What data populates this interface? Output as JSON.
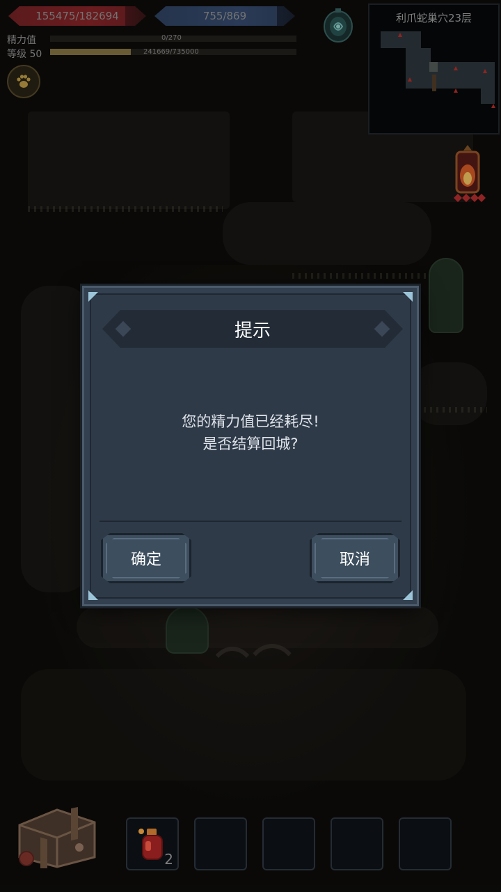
{
  "hud": {
    "hp_text": "155475/182694",
    "hp_fraction": 0.851,
    "mp_text": "755/869",
    "mp_fraction": 0.869,
    "energy_label": "精力值",
    "energy_text": "0/270",
    "energy_fraction": 0,
    "level_label": "等级 50",
    "exp_text": "241669/735000",
    "exp_fraction": 0.329,
    "paw_icon": "paw-icon",
    "portal_icon": "portal-icon",
    "lantern_icon": "lantern-icon"
  },
  "minimap": {
    "title": "利爪蛇巢穴23层"
  },
  "dialog": {
    "title": "提示",
    "message_line1": "您的精力值已经耗尽!",
    "message_line2": "是否结算回城?",
    "confirm_label": "确定",
    "cancel_label": "取消"
  },
  "bottom_bar": {
    "chest_icon": "treasure-chest-icon",
    "slots": [
      {
        "icon": "potion-icon",
        "count": "2"
      },
      {
        "icon": "",
        "count": ""
      },
      {
        "icon": "",
        "count": ""
      },
      {
        "icon": "",
        "count": ""
      },
      {
        "icon": "",
        "count": ""
      }
    ]
  },
  "colors": {
    "hp": "#7a2024",
    "mp": "#2a3a58",
    "exp": "#8c7a44",
    "dialog_bg": "#2e3a48",
    "dialog_border": "#4c5b6c",
    "text_white": "#ffffff"
  }
}
